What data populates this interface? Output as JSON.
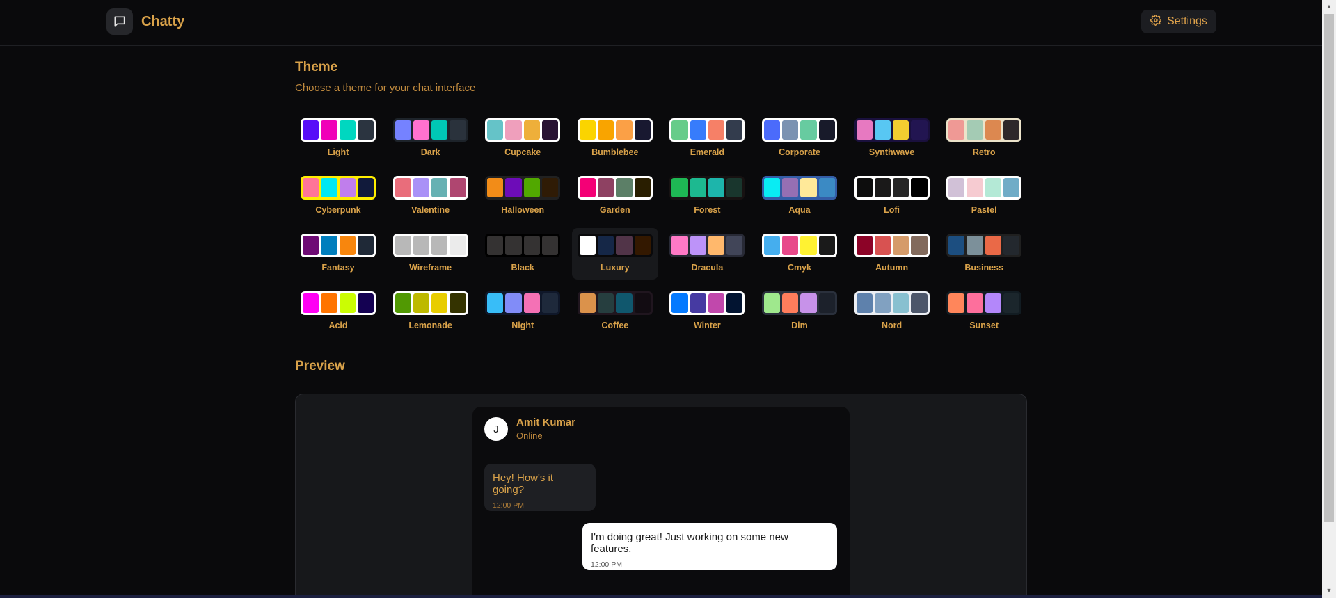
{
  "app": {
    "name": "Chatty"
  },
  "header": {
    "settings_label": "Settings"
  },
  "theme_section": {
    "title": "Theme",
    "subtitle": "Choose a theme for your chat interface",
    "selected": "Luxury",
    "themes": [
      {
        "name": "Light",
        "frame": "#ffffff",
        "colors": [
          "#570df8",
          "#f000b8",
          "#00d7c0",
          "#2b3440"
        ]
      },
      {
        "name": "Dark",
        "frame": "#1d232a",
        "colors": [
          "#7582ff",
          "#ff71cf",
          "#00c7b5",
          "#2a323c"
        ]
      },
      {
        "name": "Cupcake",
        "frame": "#ffffff",
        "colors": [
          "#65c3c8",
          "#ef9fbc",
          "#eeaf3a",
          "#291334"
        ]
      },
      {
        "name": "Bumblebee",
        "frame": "#ffffff",
        "colors": [
          "#fbd400",
          "#f9a400",
          "#fba046",
          "#181830"
        ]
      },
      {
        "name": "Emerald",
        "frame": "#ffffff",
        "colors": [
          "#66cc8a",
          "#377cfb",
          "#f68067",
          "#333c4d"
        ]
      },
      {
        "name": "Corporate",
        "frame": "#ffffff",
        "colors": [
          "#4b6bfb",
          "#7b92b2",
          "#67cba0",
          "#181a2a"
        ]
      },
      {
        "name": "Synthwave",
        "frame": "#1a103d",
        "colors": [
          "#e779c1",
          "#58c7f3",
          "#f3cc30",
          "#221551"
        ]
      },
      {
        "name": "Retro",
        "frame": "#ece3ca",
        "colors": [
          "#ef9995",
          "#a4cbb4",
          "#dc8850",
          "#2e282a"
        ]
      },
      {
        "name": "Cyberpunk",
        "frame": "#ffee00",
        "colors": [
          "#ff7598",
          "#00e8f2",
          "#c07eec",
          "#111a3b"
        ]
      },
      {
        "name": "Valentine",
        "frame": "#ffffff",
        "colors": [
          "#e96d7b",
          "#a991f7",
          "#66b1b3",
          "#af4670"
        ]
      },
      {
        "name": "Halloween",
        "frame": "#212121",
        "colors": [
          "#f28c18",
          "#6d0cb8",
          "#51a800",
          "#2f1b05"
        ]
      },
      {
        "name": "Garden",
        "frame": "#ffffff",
        "colors": [
          "#f40076",
          "#8e4162",
          "#5c7f67",
          "#291e00"
        ]
      },
      {
        "name": "Forest",
        "frame": "#171212",
        "colors": [
          "#1eb854",
          "#1db990",
          "#1db5ab",
          "#19362d"
        ]
      },
      {
        "name": "Aqua",
        "frame": "#345da7",
        "colors": [
          "#09ecf3",
          "#966fb3",
          "#ffe999",
          "#3b8ac4"
        ]
      },
      {
        "name": "Lofi",
        "frame": "#ffffff",
        "colors": [
          "#0d0d0d",
          "#1a1919",
          "#262626",
          "#000000"
        ]
      },
      {
        "name": "Pastel",
        "frame": "#ffffff",
        "colors": [
          "#d1c1d7",
          "#f6cbd1",
          "#b4e9d6",
          "#70acc7"
        ]
      },
      {
        "name": "Fantasy",
        "frame": "#ffffff",
        "colors": [
          "#6e0b75",
          "#007ebd",
          "#f8860d",
          "#1f2937"
        ]
      },
      {
        "name": "Wireframe",
        "frame": "#ffffff",
        "colors": [
          "#b8b8b8",
          "#b8b8b8",
          "#b8b8b8",
          "#ebebeb"
        ]
      },
      {
        "name": "Black",
        "frame": "#000000",
        "colors": [
          "#343232",
          "#343232",
          "#343232",
          "#343232"
        ]
      },
      {
        "name": "Luxury",
        "frame": "#09090b",
        "colors": [
          "#ffffff",
          "#152747",
          "#513448",
          "#331800"
        ]
      },
      {
        "name": "Dracula",
        "frame": "#282a36",
        "colors": [
          "#ff79c6",
          "#bd93f9",
          "#ffb86c",
          "#414558"
        ]
      },
      {
        "name": "Cmyk",
        "frame": "#ffffff",
        "colors": [
          "#45aeee",
          "#e8488a",
          "#fff232",
          "#1a1a1a"
        ]
      },
      {
        "name": "Autumn",
        "frame": "#ffffff",
        "colors": [
          "#8c0327",
          "#d85251",
          "#d59b6a",
          "#826a5c"
        ]
      },
      {
        "name": "Business",
        "frame": "#202020",
        "colors": [
          "#1c4e80",
          "#7c909a",
          "#ea6947",
          "#23282e"
        ]
      },
      {
        "name": "Acid",
        "frame": "#ffffff",
        "colors": [
          "#ff00f4",
          "#ff7400",
          "#cbfd03",
          "#140152"
        ]
      },
      {
        "name": "Lemonade",
        "frame": "#ffffff",
        "colors": [
          "#519903",
          "#bdb900",
          "#e8cd00",
          "#343300"
        ]
      },
      {
        "name": "Night",
        "frame": "#0f1729",
        "colors": [
          "#38bdf8",
          "#818cf8",
          "#f471b5",
          "#1e293b"
        ]
      },
      {
        "name": "Coffee",
        "frame": "#20161f",
        "colors": [
          "#db924b",
          "#263e3f",
          "#10576d",
          "#120c12"
        ]
      },
      {
        "name": "Winter",
        "frame": "#ffffff",
        "colors": [
          "#047aff",
          "#463aa2",
          "#c148ac",
          "#021431"
        ]
      },
      {
        "name": "Dim",
        "frame": "#2a303c",
        "colors": [
          "#9fe88d",
          "#ff7d5c",
          "#c792e9",
          "#1c212b"
        ]
      },
      {
        "name": "Nord",
        "frame": "#eceff4",
        "colors": [
          "#5e81ac",
          "#81a1c1",
          "#88c0d0",
          "#4c566a"
        ]
      },
      {
        "name": "Sunset",
        "frame": "#121c22",
        "colors": [
          "#ff865b",
          "#fd6f9c",
          "#b387fa",
          "#1b262c"
        ]
      }
    ]
  },
  "preview": {
    "title": "Preview",
    "contact": {
      "initial": "J",
      "name": "Amit Kumar",
      "status": "Online"
    },
    "messages": [
      {
        "text": "Hey! How's it going?",
        "time": "12:00 PM",
        "sent": false
      },
      {
        "text": "I'm doing great! Just working on some new features.",
        "time": "12:00 PM",
        "sent": true
      }
    ]
  },
  "icons": [
    "chat-bubble-icon",
    "gear-icon"
  ]
}
